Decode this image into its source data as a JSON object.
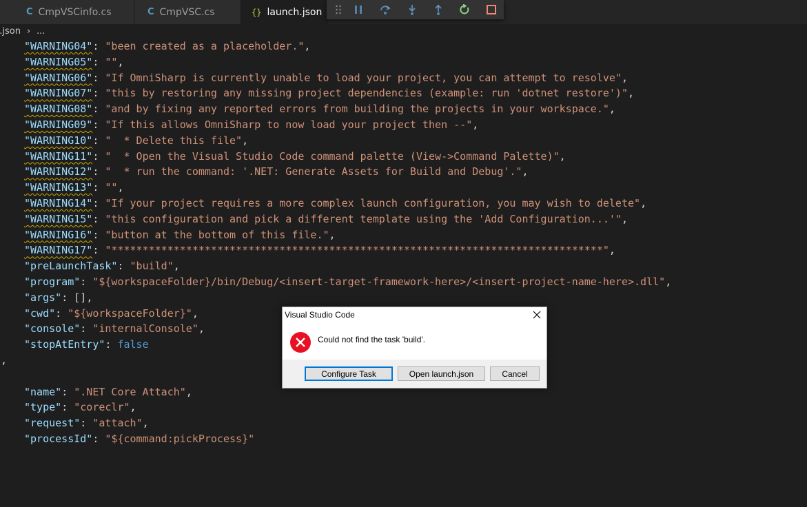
{
  "tabs": [
    {
      "label": "CmpVSCinfo.cs",
      "icon": "csharp-icon"
    },
    {
      "label": "CmpVSC.cs",
      "icon": "csharp-icon"
    },
    {
      "label": "launch.json",
      "icon": "json-braces-icon"
    }
  ],
  "tab_icons": {
    "csharp": "C#",
    "json": "{}"
  },
  "debug_toolbar": {
    "icons": [
      "drag-handle-icon",
      "pause-icon",
      "step-over-icon",
      "step-into-icon",
      "step-out-icon",
      "restart-icon",
      "stop-icon"
    ]
  },
  "breadcrumb": {
    "file": "n.json",
    "separator": "›",
    "rest": "..."
  },
  "editor": {
    "warnings": [
      {
        "key": "\"WARNING04\"",
        "value": "\"been created as a placeholder.\""
      },
      {
        "key": "\"WARNING05\"",
        "value": "\"\""
      },
      {
        "key": "\"WARNING06\"",
        "value": "\"If OmniSharp is currently unable to load your project, you can attempt to resolve\""
      },
      {
        "key": "\"WARNING07\"",
        "value": "\"this by restoring any missing project dependencies (example: run 'dotnet restore')\""
      },
      {
        "key": "\"WARNING08\"",
        "value": "\"and by fixing any reported errors from building the projects in your workspace.\""
      },
      {
        "key": "\"WARNING09\"",
        "value": "\"If this allows OmniSharp to now load your project then --\""
      },
      {
        "key": "\"WARNING10\"",
        "value": "\"  * Delete this file\""
      },
      {
        "key": "\"WARNING11\"",
        "value": "\"  * Open the Visual Studio Code command palette (View->Command Palette)\""
      },
      {
        "key": "\"WARNING12\"",
        "value": "\"  * run the command: '.NET: Generate Assets for Build and Debug'.\""
      },
      {
        "key": "\"WARNING13\"",
        "value": "\"\""
      },
      {
        "key": "\"WARNING14\"",
        "value": "\"If your project requires a more complex launch configuration, you may wish to delete\""
      },
      {
        "key": "\"WARNING15\"",
        "value": "\"this configuration and pick a different template using the 'Add Configuration...'\""
      },
      {
        "key": "\"WARNING16\"",
        "value": "\"button at the bottom of this file.\""
      },
      {
        "key": "\"WARNING17\"",
        "value": "\"*******************************************************************************\""
      }
    ],
    "props1": [
      {
        "key": "\"preLaunchTask\"",
        "value": "\"build\"",
        "type": "string"
      },
      {
        "key": "\"program\"",
        "value": "\"${workspaceFolder}/bin/Debug/<insert-target-framework-here>/<insert-project-name-here>.dll\"",
        "type": "string"
      },
      {
        "key": "\"args\"",
        "value": "[]",
        "type": "punct"
      },
      {
        "key": "\"cwd\"",
        "value": "\"${workspaceFolder}\"",
        "type": "string"
      },
      {
        "key": "\"console\"",
        "value": "\"internalConsole\"",
        "type": "string"
      },
      {
        "key": "\"stopAtEntry\"",
        "value": "false",
        "type": "bool"
      }
    ],
    "close_obj": "},",
    "open_obj": "{",
    "props2": [
      {
        "key": "\"name\"",
        "value": "\".NET Core Attach\""
      },
      {
        "key": "\"type\"",
        "value": "\"coreclr\""
      },
      {
        "key": "\"request\"",
        "value": "\"attach\""
      },
      {
        "key": "\"processId\"",
        "value": "\"${command:pickProcess}\""
      }
    ],
    "close_last": "}"
  },
  "dialog": {
    "title": "Visual Studio Code",
    "message": "Could not find the task 'build'.",
    "buttons": {
      "configure": "Configure Task",
      "open": "Open launch.json",
      "cancel": "Cancel"
    },
    "icon": "error-icon",
    "close_icon": "close-icon"
  },
  "colors": {
    "error_red": "#e81123",
    "default_button_border": "#0078d7"
  }
}
